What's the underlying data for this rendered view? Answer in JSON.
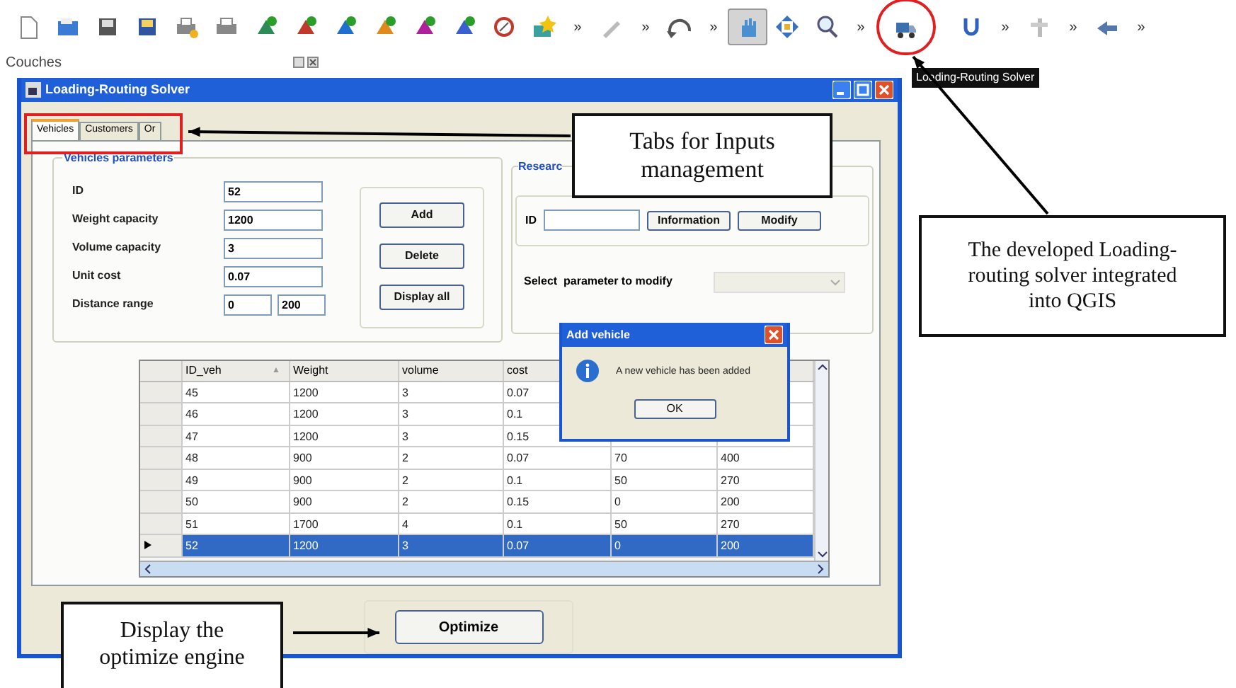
{
  "toolbar": {
    "items": [
      {
        "kind": "new",
        "selected": false
      },
      {
        "kind": "open",
        "selected": false
      },
      {
        "kind": "save",
        "selected": false
      },
      {
        "kind": "saveas",
        "selected": false
      },
      {
        "kind": "preview",
        "selected": false
      },
      {
        "kind": "print",
        "selected": false
      },
      {
        "kind": "layer",
        "color": "#2e8b57",
        "selected": false
      },
      {
        "kind": "layer",
        "color": "#c0392b",
        "selected": false
      },
      {
        "kind": "layer",
        "color": "#1e6fd0",
        "selected": false
      },
      {
        "kind": "layer",
        "color": "#e08a1e",
        "selected": false
      },
      {
        "kind": "layer",
        "color": "#b0209a",
        "selected": false
      },
      {
        "kind": "layer",
        "color": "#3a5fd0",
        "selected": false
      },
      {
        "kind": "compass",
        "selected": false
      },
      {
        "kind": "star",
        "selected": false
      },
      {
        "kind": "more",
        "label": "»"
      },
      {
        "kind": "pencil",
        "selected": false
      },
      {
        "kind": "more",
        "label": "»"
      },
      {
        "kind": "undo",
        "selected": false
      },
      {
        "kind": "more",
        "label": "»"
      },
      {
        "kind": "hand",
        "selected": true
      },
      {
        "kind": "pan",
        "selected": false
      },
      {
        "kind": "zoom",
        "selected": false
      },
      {
        "kind": "more",
        "label": "»"
      },
      {
        "kind": "truck",
        "selected": false
      },
      {
        "kind": "magnet",
        "selected": false
      },
      {
        "kind": "more",
        "label": "»"
      },
      {
        "kind": "tree",
        "selected": false
      },
      {
        "kind": "more",
        "label": "»"
      },
      {
        "kind": "arrows",
        "selected": false
      },
      {
        "kind": "more",
        "label": "»"
      }
    ]
  },
  "tooltip": "Loading-Routing Solver",
  "dock": {
    "title": "Couches"
  },
  "window": {
    "title": "Loading-Routing Solver"
  },
  "tabs": [
    {
      "label": "Vehicles",
      "selected": true
    },
    {
      "label": "Customers",
      "selected": false
    },
    {
      "label": "Or",
      "selected": false
    }
  ],
  "vehicle_params": {
    "title": "Vehicles parameters",
    "fields": [
      {
        "label": "ID",
        "values": [
          "52"
        ]
      },
      {
        "label": "Weight capacity",
        "values": [
          "1200"
        ]
      },
      {
        "label": "Volume capacity",
        "values": [
          "3"
        ]
      },
      {
        "label": "Unit cost",
        "values": [
          "0.07"
        ]
      },
      {
        "label": "Distance range",
        "values": [
          "0",
          "200"
        ]
      }
    ],
    "buttons": [
      "Add",
      "Delete",
      "Display all"
    ]
  },
  "research": {
    "title": "Researc",
    "id_label": "ID",
    "buttons": [
      "Information",
      "Modify"
    ],
    "select_label": "Select  parameter to modify"
  },
  "table": {
    "columns": [
      "ID_veh",
      "Weight",
      "volume",
      "cost"
    ],
    "sort_mark": "▲",
    "rows": [
      {
        "cells": [
          "45",
          "1200",
          "3",
          "0.07"
        ],
        "selected": false,
        "current": false
      },
      {
        "cells": [
          "46",
          "1200",
          "3",
          "0.1"
        ],
        "selected": false,
        "current": false
      },
      {
        "cells": [
          "47",
          "1200",
          "3",
          "0.15"
        ],
        "selected": false,
        "current": false
      },
      {
        "cells": [
          "48",
          "900",
          "2",
          "0.07",
          "70",
          "400"
        ],
        "selected": false,
        "current": false
      },
      {
        "cells": [
          "49",
          "900",
          "2",
          "0.1",
          "50",
          "270"
        ],
        "selected": false,
        "current": false
      },
      {
        "cells": [
          "50",
          "900",
          "2",
          "0.15",
          "0",
          "200"
        ],
        "selected": false,
        "current": false
      },
      {
        "cells": [
          "51",
          "1700",
          "4",
          "0.1",
          "50",
          "270"
        ],
        "selected": false,
        "current": false
      },
      {
        "cells": [
          "52",
          "1200",
          "3",
          "0.07",
          "0",
          "200"
        ],
        "selected": true,
        "current": true
      }
    ]
  },
  "message_box": {
    "title": "Add vehicle",
    "text": "A new vehicle has been added",
    "button": "OK"
  },
  "optimize_button": "Optimize",
  "annotations": [
    {
      "kind": "tabs",
      "text": "Tabs for Inputs management"
    },
    {
      "kind": "solver",
      "text": "The developed Loading-routing solver integrated into QGIS"
    },
    {
      "kind": "optimize",
      "text": "Display the optimize engine"
    }
  ]
}
